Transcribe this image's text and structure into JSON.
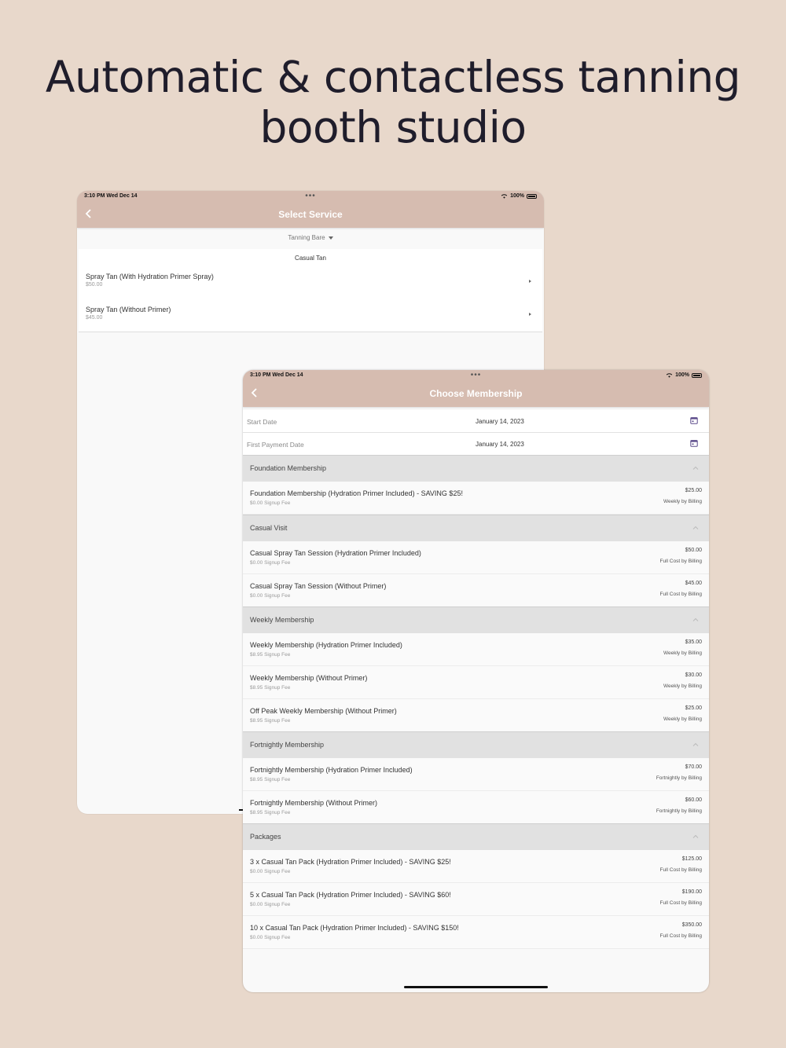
{
  "headline": {
    "line1": "Automatic & contactless tanning",
    "line2": "booth studio"
  },
  "colors": {
    "background": "#e8d8cb",
    "navbar": "#d6bcb0",
    "section_header": "#e1e1e1",
    "calendar_icon": "#5b4a8a"
  },
  "service_screen": {
    "status": {
      "time": "3:10 PM   Wed Dec 14",
      "dots": "•••",
      "battery": "100%"
    },
    "title": "Select Service",
    "back_icon": "chevron-left-icon",
    "location_dropdown": "Tanning Bare",
    "group_label": "Casual Tan",
    "services": [
      {
        "name": "Spray Tan (With Hydration Primer Spray)",
        "price": "$50.00"
      },
      {
        "name": "Spray Tan (Without Primer)",
        "price": "$45.00"
      }
    ]
  },
  "membership_screen": {
    "status": {
      "time": "3:10 PM   Wed Dec 14",
      "dots": "•••",
      "battery": "100%"
    },
    "title": "Choose Membership",
    "back_icon": "chevron-left-icon",
    "start_date": {
      "label": "Start Date",
      "value": "January 14, 2023",
      "icon": "calendar-icon"
    },
    "first_payment_date": {
      "label": "First Payment Date",
      "value": "January 14, 2023",
      "icon": "calendar-icon"
    },
    "sections": [
      {
        "title": "Foundation Membership",
        "items": [
          {
            "name": "Foundation Membership (Hydration Primer Included) - SAVING $25!",
            "fee": "$0.00 Signup Fee",
            "price": "$25.00",
            "billing": "Weekly by Billing"
          }
        ]
      },
      {
        "title": "Casual Visit",
        "items": [
          {
            "name": "Casual Spray Tan Session (Hydration Primer Included)",
            "fee": "$0.00 Signup Fee",
            "price": "$50.00",
            "billing": "Full Cost by Billing"
          },
          {
            "name": "Casual Spray Tan Session (Without Primer)",
            "fee": "$0.00 Signup Fee",
            "price": "$45.00",
            "billing": "Full Cost by Billing"
          }
        ]
      },
      {
        "title": "Weekly Membership",
        "items": [
          {
            "name": "Weekly Membership (Hydration Primer Included)",
            "fee": "$8.95 Signup Fee",
            "price": "$35.00",
            "billing": "Weekly by Billing"
          },
          {
            "name": "Weekly Membership (Without Primer)",
            "fee": "$8.95 Signup Fee",
            "price": "$30.00",
            "billing": "Weekly by Billing"
          },
          {
            "name": "Off Peak Weekly Membership (Without Primer)",
            "fee": "$8.95 Signup Fee",
            "price": "$25.00",
            "billing": "Weekly by Billing"
          }
        ]
      },
      {
        "title": "Fortnightly Membership",
        "items": [
          {
            "name": "Fortnightly Membership (Hydration Primer Included)",
            "fee": "$8.95 Signup Fee",
            "price": "$70.00",
            "billing": "Fortnightly by Billing"
          },
          {
            "name": "Fortnightly Membership (Without Primer)",
            "fee": "$8.95 Signup Fee",
            "price": "$60.00",
            "billing": "Fortnightly by Billing"
          }
        ]
      },
      {
        "title": "Packages",
        "items": [
          {
            "name": "3 x Casual Tan Pack (Hydration Primer Included) - SAVING $25!",
            "fee": "$0.00 Signup Fee",
            "price": "$125.00",
            "billing": "Full Cost by Billing"
          },
          {
            "name": "5 x Casual Tan Pack (Hydration Primer Included) - SAVING $60!",
            "fee": "$0.00 Signup Fee",
            "price": "$190.00",
            "billing": "Full Cost by Billing"
          },
          {
            "name": "10 x Casual Tan Pack (Hydration Primer Included) - SAVING $150!",
            "fee": "$0.00 Signup Fee",
            "price": "$350.00",
            "billing": "Full Cost by Billing"
          }
        ]
      }
    ]
  }
}
